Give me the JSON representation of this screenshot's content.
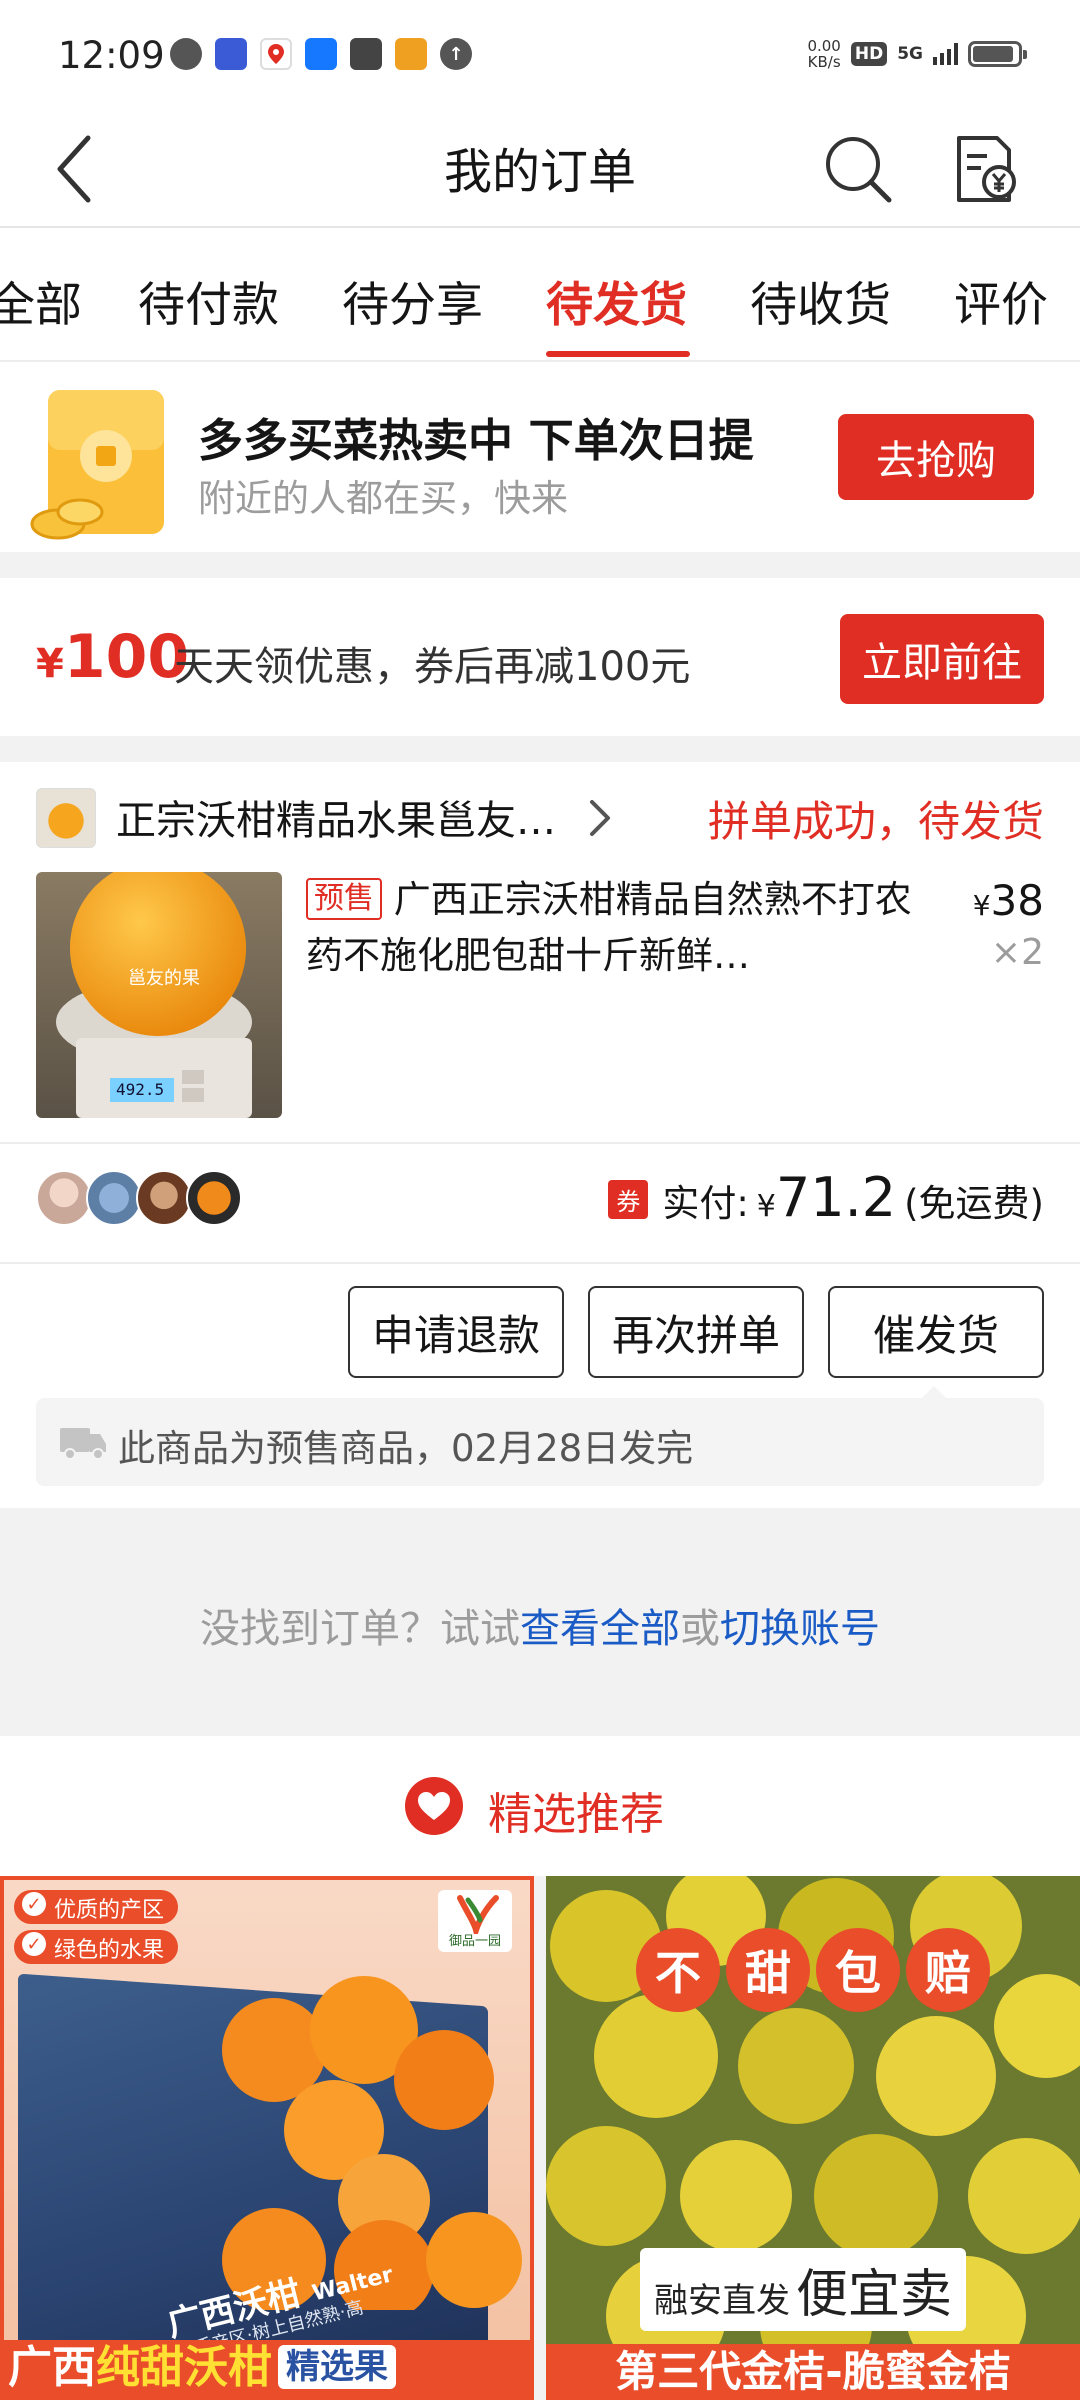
{
  "status_bar": {
    "time": "12:09",
    "speed_value": "0.00",
    "speed_unit": "KB/s",
    "hd": "HD",
    "network": "5G"
  },
  "header": {
    "title": "我的订单"
  },
  "tabs": [
    {
      "label": "全部"
    },
    {
      "label": "待付款"
    },
    {
      "label": "待分享"
    },
    {
      "label": "待发货",
      "active": true
    },
    {
      "label": "待收货"
    },
    {
      "label": "评价"
    }
  ],
  "promo": {
    "title": "多多买菜热卖中 下单次日提",
    "subtitle": "附近的人都在买，快来",
    "button": "去抢购"
  },
  "coupon": {
    "currency": "¥",
    "amount": "100",
    "text": "天天领优惠，券后再减100元",
    "button": "立即前往"
  },
  "order": {
    "store_name": "正宗沃柑精品水果邕友…",
    "status": "拼单成功，待发货",
    "product": {
      "tag": "预售",
      "title": "广西正宗沃柑精品自然熟不打农药不施化肥包甜十斤新鲜…",
      "image_watermark": "邕友的果",
      "scale_reading": "492.5",
      "currency": "¥",
      "price": "38",
      "quantity": "×2"
    },
    "payment": {
      "coupon_badge": "券",
      "label": "实付:",
      "currency": "¥",
      "amount": "71.2",
      "note": "(免运费)"
    },
    "buttons": {
      "refund": "申请退款",
      "regroup": "再次拼单",
      "urge": "催发货"
    },
    "shipping_note": "此商品为预售商品，02月28日发完"
  },
  "not_found": {
    "prefix": "没找到订单？试试",
    "view_all": "查看全部",
    "or": "或",
    "switch_account": "切换账号"
  },
  "recommend": {
    "title": "精选推荐",
    "items": [
      {
        "pill_1": "优质的产区",
        "pill_2": "绿色的水果",
        "brand": "御品一园",
        "box_label": "广西沃柑",
        "box_brand": "Walter",
        "box_sub": "优质产区·树上自然熟·高",
        "caption_start": "广西",
        "caption_highlight": "纯甜沃柑",
        "caption_tag": "精选果"
      },
      {
        "badge_1": "不",
        "badge_2": "甜",
        "badge_3": "包",
        "badge_4": "赔",
        "tag_small": "融安直发",
        "tag_big": "便宜卖",
        "caption": "第三代金桔-脆蜜金桔"
      }
    ]
  },
  "colors": {
    "brand_red": "#e02e24",
    "link_blue": "#1b5bc5",
    "muted_text": "#9c9c9c"
  }
}
